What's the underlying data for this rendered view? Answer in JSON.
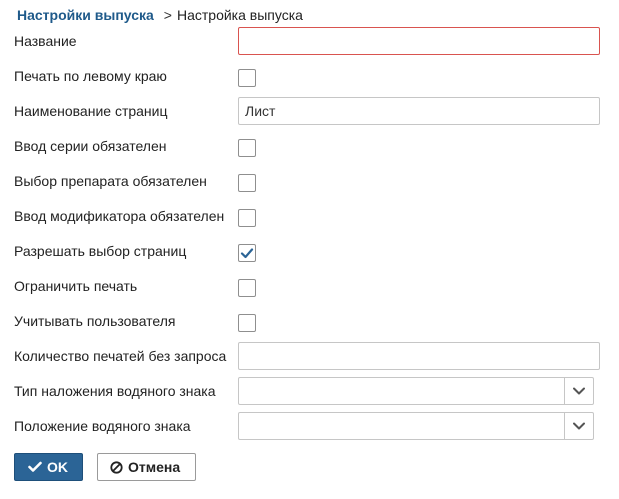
{
  "breadcrumb": {
    "parent": "Настройки выпуска",
    "separator": ">",
    "current": "Настройка выпуска"
  },
  "form": {
    "name": {
      "label": "Название",
      "value": ""
    },
    "print_left": {
      "label": "Печать по левому краю",
      "checked": false
    },
    "pages_name": {
      "label": "Наименование страниц",
      "value": "Лист"
    },
    "series_required": {
      "label": "Ввод серии обязателен",
      "checked": false
    },
    "drug_required": {
      "label": "Выбор препарата обязателен",
      "checked": false
    },
    "modifier_required": {
      "label": "Ввод модификатора обязателен",
      "checked": false
    },
    "allow_page_select": {
      "label": "Разрешать выбор страниц",
      "checked": true
    },
    "limit_print": {
      "label": "Ограничить печать",
      "checked": false
    },
    "track_user": {
      "label": "Учитывать пользователя",
      "checked": false
    },
    "print_count": {
      "label": "Количество печатей без запроса",
      "value": ""
    },
    "watermark_type": {
      "label": "Тип наложения водяного знака",
      "value": ""
    },
    "watermark_position": {
      "label": "Положение водяного знака",
      "value": ""
    }
  },
  "actions": {
    "ok_label": "OK",
    "cancel_label": "Отмена"
  },
  "icons": {
    "checkmark": "check-icon",
    "ok": "check-icon",
    "cancel": "ban-icon",
    "dropdown": "chevron-down-icon"
  },
  "colors": {
    "breadcrumb_link": "#1f5a8a",
    "primary_button": "#2b6496",
    "check_mark": "#2b6496",
    "invalid_border": "#d9534f"
  }
}
